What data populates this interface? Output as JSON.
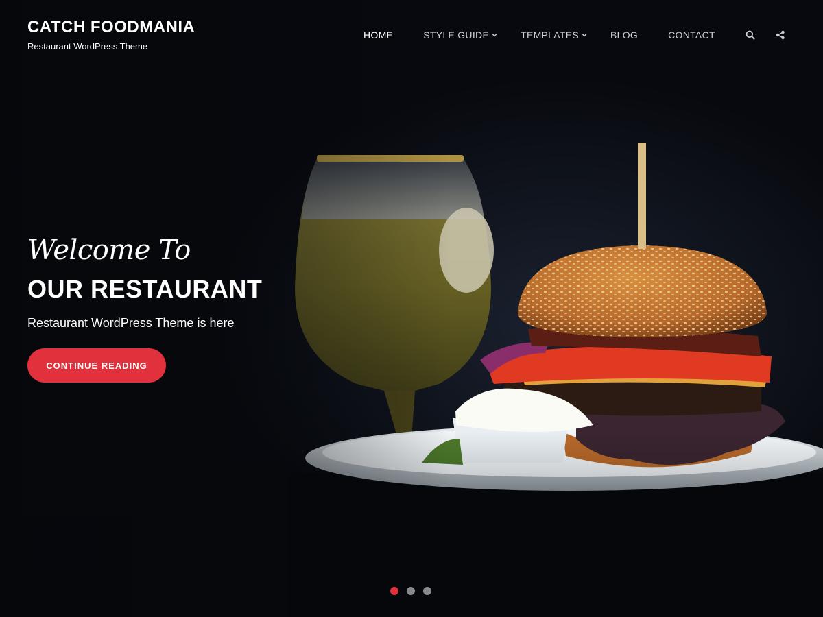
{
  "site": {
    "title": "CATCH FOODMANIA",
    "tagline": "Restaurant WordPress Theme"
  },
  "nav": {
    "items": [
      {
        "label": "HOME",
        "active": true,
        "has_submenu": false
      },
      {
        "label": "STYLE GUIDE",
        "active": false,
        "has_submenu": true
      },
      {
        "label": "TEMPLATES",
        "active": false,
        "has_submenu": true
      },
      {
        "label": "BLOG",
        "active": false,
        "has_submenu": false
      },
      {
        "label": "CONTACT",
        "active": false,
        "has_submenu": false
      }
    ],
    "icons": [
      "search-icon",
      "share-icon"
    ]
  },
  "hero": {
    "welcome": "Welcome To",
    "headline": "OUR RESTAURANT",
    "subtext": "Restaurant WordPress Theme is here",
    "cta_label": "CONTINUE READING"
  },
  "slider": {
    "total_slides": 3,
    "active_slide": 1
  },
  "colors": {
    "accent": "#e0313d",
    "background": "#07090e",
    "text": "#ffffff",
    "menu_text": "#cfd3da",
    "dot_inactive": "#888a8e"
  }
}
